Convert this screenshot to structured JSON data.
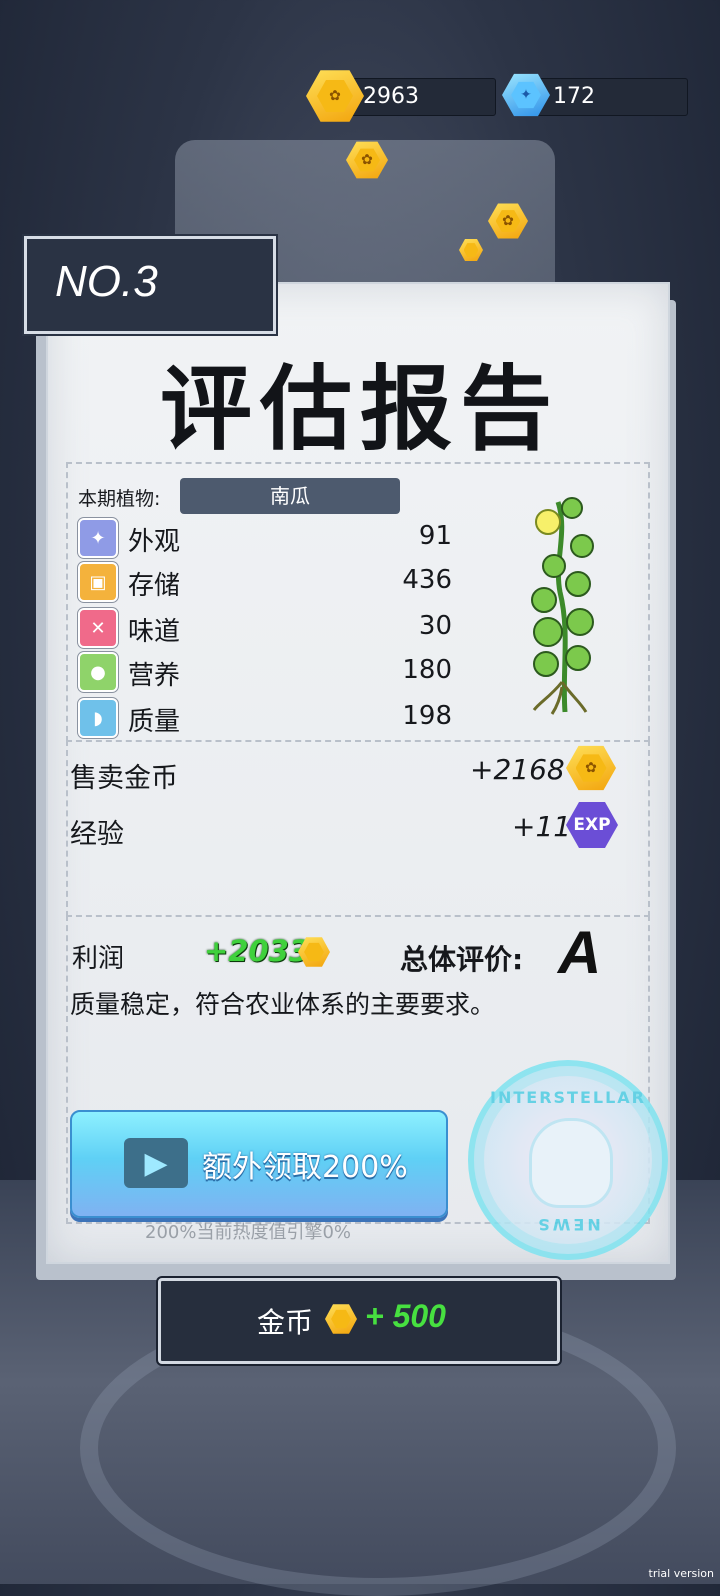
{
  "currency": {
    "coins": "2963",
    "gems": "172"
  },
  "card": {
    "number": "NO.3",
    "title": "评估报告",
    "plant_label": "本期植物:",
    "plant_name": "南瓜",
    "stats": [
      {
        "label": "外观",
        "value": "91",
        "icon": "sparkle-icon",
        "color": "#8f9be6"
      },
      {
        "label": "存储",
        "value": "436",
        "icon": "box-icon",
        "color": "#f4b23c"
      },
      {
        "label": "味道",
        "value": "30",
        "icon": "utensils-icon",
        "color": "#f06a8a"
      },
      {
        "label": "营养",
        "value": "180",
        "icon": "nutrition-icon",
        "color": "#8fd36a"
      },
      {
        "label": "质量",
        "value": "198",
        "icon": "muscle-icon",
        "color": "#6fc1ea"
      }
    ],
    "sell_label": "售卖金币",
    "sell_value": "+2168",
    "exp_label": "经验",
    "exp_value": "+11",
    "exp_badge": "EXP",
    "profit_label": "利润",
    "profit_value": "+2033",
    "grade_label": "总体评价:",
    "grade": "A",
    "comment": "质量稳定，符合农业体系的主要要求。",
    "video_button": "额外领取200%",
    "heat_note": "200%当前热度值引擎0%",
    "stamp_top": "INTERSTELLAR",
    "stamp_bottom": "NEWS"
  },
  "reward": {
    "label": "金币",
    "value": "+ 500"
  },
  "watermark": "trial version"
}
